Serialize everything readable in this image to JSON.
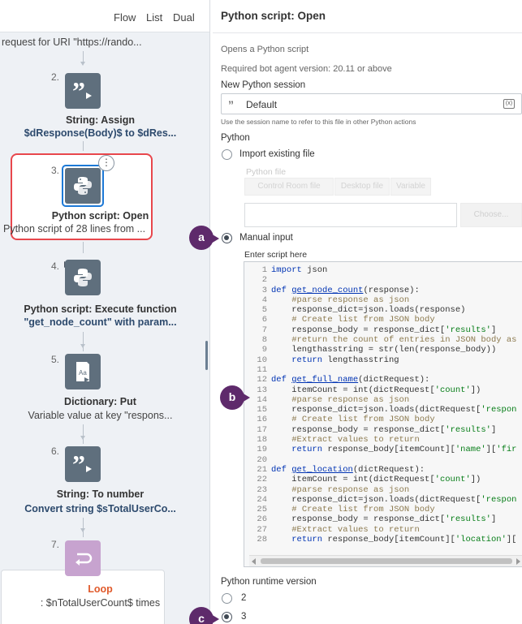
{
  "left_panel": {
    "tabs": [
      "Flow",
      "List",
      "Dual"
    ],
    "top_text": "request for URI \"https://rando...",
    "nodes": [
      {
        "num": "2.",
        "title": "String: Assign",
        "subtitle": "$dResponse(Body)$ to $dRes...",
        "icon": "quote-icon"
      },
      {
        "num": "3.",
        "title": "Python script: Open",
        "subtitle": "Python script of 28 lines from ...",
        "icon": "python-icon",
        "selected": true
      },
      {
        "num": "4.",
        "title": "Python script: Execute function",
        "subtitle": "\"get_node_count\" with param...",
        "icon": "python-icon"
      },
      {
        "num": "5.",
        "title": "Dictionary: Put",
        "subtitle": "Variable value at key \"respons...",
        "icon": "dictionary-icon"
      },
      {
        "num": "6.",
        "title": "String: To number",
        "subtitle": "Convert string $sTotalUserCo...",
        "icon": "quote-icon"
      },
      {
        "num": "7.",
        "title": "Loop",
        "subtitle": ": $nTotalUserCount$ times",
        "icon": "loop-icon"
      }
    ],
    "more_label": "⋮"
  },
  "panel": {
    "title": "Python script: Open",
    "description": "Opens a Python script",
    "version_note": "Required bot agent version: 20.11 or above",
    "session_label": "New Python session",
    "session_value": "Default",
    "session_hint": "Use the session name to refer to this file in other Python actions",
    "var_button": "(x)",
    "python_label": "Python",
    "import_option": "Import existing file",
    "python_file_label": "Python file",
    "file_tabs": [
      "Control Room file",
      "Desktop file",
      "Variable"
    ],
    "choose_button": "Choose...",
    "manual_option": "Manual input",
    "script_label": "Enter script here",
    "runtime_label": "Python runtime version",
    "runtime_options": [
      "2",
      "3"
    ]
  },
  "callouts": [
    "a",
    "b",
    "c"
  ],
  "code_lines": [
    "import json",
    "",
    "def get_node_count(response):",
    "    #parse response as json",
    "    response_dict=json.loads(response)",
    "    # Create list from JSON body",
    "    response_body = response_dict['results']",
    "    #return the count of entries in JSON body as",
    "    lengthasstring = str(len(response_body))",
    "    return lengthasstring",
    "",
    "def get_full_name(dictRequest):",
    "    itemCount = int(dictRequest['count'])",
    "    #parse response as json",
    "    response_dict=json.loads(dictRequest['respon",
    "    # Create list from JSON body",
    "    response_body = response_dict['results']",
    "    #Extract values to return",
    "    return response_body[itemCount]['name']['fir",
    "",
    "def get_location(dictRequest):",
    "    itemCount = int(dictRequest['count'])",
    "    #parse response as json",
    "    response_dict=json.loads(dictRequest['respon",
    "    # Create list from JSON body",
    "    response_body = response_dict['results']",
    "    #Extract values to return",
    "    return response_body[itemCount]['location']["
  ],
  "colors": {
    "callout": "#5e2a6b",
    "selection": "#e8474c",
    "focus": "#1d79d6",
    "node_icon": "#5f6f7d",
    "loop_icon": "#c7a3cf"
  }
}
